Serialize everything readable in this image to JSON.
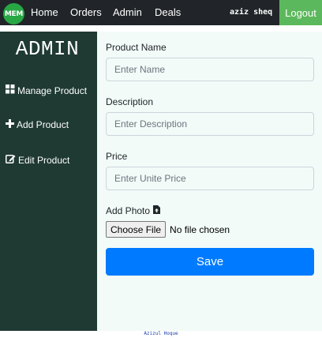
{
  "navbar": {
    "logo_text": "MEM",
    "links": [
      "Home",
      "Orders",
      "Admin",
      "Deals"
    ],
    "username": "aziz sheq",
    "logout_label": "Logout"
  },
  "sidebar": {
    "title": "ADMIN",
    "items": [
      {
        "label": "Manage Product",
        "icon": "grid-icon"
      },
      {
        "label": "Add Product",
        "icon": "plus-icon"
      },
      {
        "label": "Edit Product",
        "icon": "edit-icon"
      }
    ]
  },
  "form": {
    "name_label": "Product Name",
    "name_placeholder": "Enter Name",
    "name_value": "",
    "description_label": "Description",
    "description_placeholder": "Enter Description",
    "description_value": "",
    "price_label": "Price",
    "price_placeholder": "Enter Unite Price",
    "price_value": "",
    "photo_label": "Add Photo",
    "photo_icon": "file-upload-icon",
    "file_button_label": "Choose File",
    "file_status": "No file chosen",
    "save_label": "Save"
  },
  "footer": {
    "text": "Azizul Hoque"
  },
  "colors": {
    "navbar_bg": "#212529",
    "logo_bg": "#28a745",
    "logout_bg": "#5cb85c",
    "sidebar_bg": "#1f3a33",
    "main_bg": "#f2fbf8",
    "save_bg": "#007bff",
    "footer_text": "#1a3fb0"
  }
}
